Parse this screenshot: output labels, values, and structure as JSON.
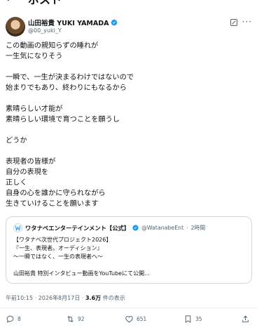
{
  "header": {
    "back_icon": "back-arrow-icon",
    "title": "ポスト"
  },
  "author": {
    "display_name": "山田裕貴 YUKI YAMADA",
    "handle": "@00_yuki_Y",
    "verified_color": "#1d9bf0"
  },
  "tweet": {
    "lines": [
      "この動画の親知らずの睡れが",
      "一生気になりそう",
      "",
      "一瞬で、一生が決まるわけではないので",
      "始まりでもあり、終わりにもなるから",
      "",
      "素晴らしい才能が",
      "素晴らしい環境で育つことを願うし",
      "",
      "どうか",
      "",
      "表現者の皆様が",
      "自分の表現を",
      "正しく",
      "自身の心を誰かに守られながら",
      "生きていけることを願います"
    ]
  },
  "quote": {
    "name": "ワタナベエンターテインメント【公式】",
    "handle": "@WatanabeEnt",
    "time": "2時間",
    "lines": [
      "【ワタナベ次世代プロジェクト2026】",
      "『一生、表現者。オーディション』",
      "〜一瞬ではなく、一生の表現者へ〜",
      "",
      "山田裕貴 特別インタビュー動画をYouTubeにて公開..."
    ]
  },
  "meta": {
    "time": "午前10:15",
    "date": "2026年8月17日",
    "views_count": "3.6万",
    "views_label": "件の表示"
  },
  "actions": {
    "replies": "8",
    "reposts": "92",
    "likes": "651",
    "bookmarks": "35"
  },
  "colors": {
    "text": "#0f1419",
    "secondary": "#536471",
    "border": "#cfd9de",
    "accent": "#1d9bf0"
  }
}
